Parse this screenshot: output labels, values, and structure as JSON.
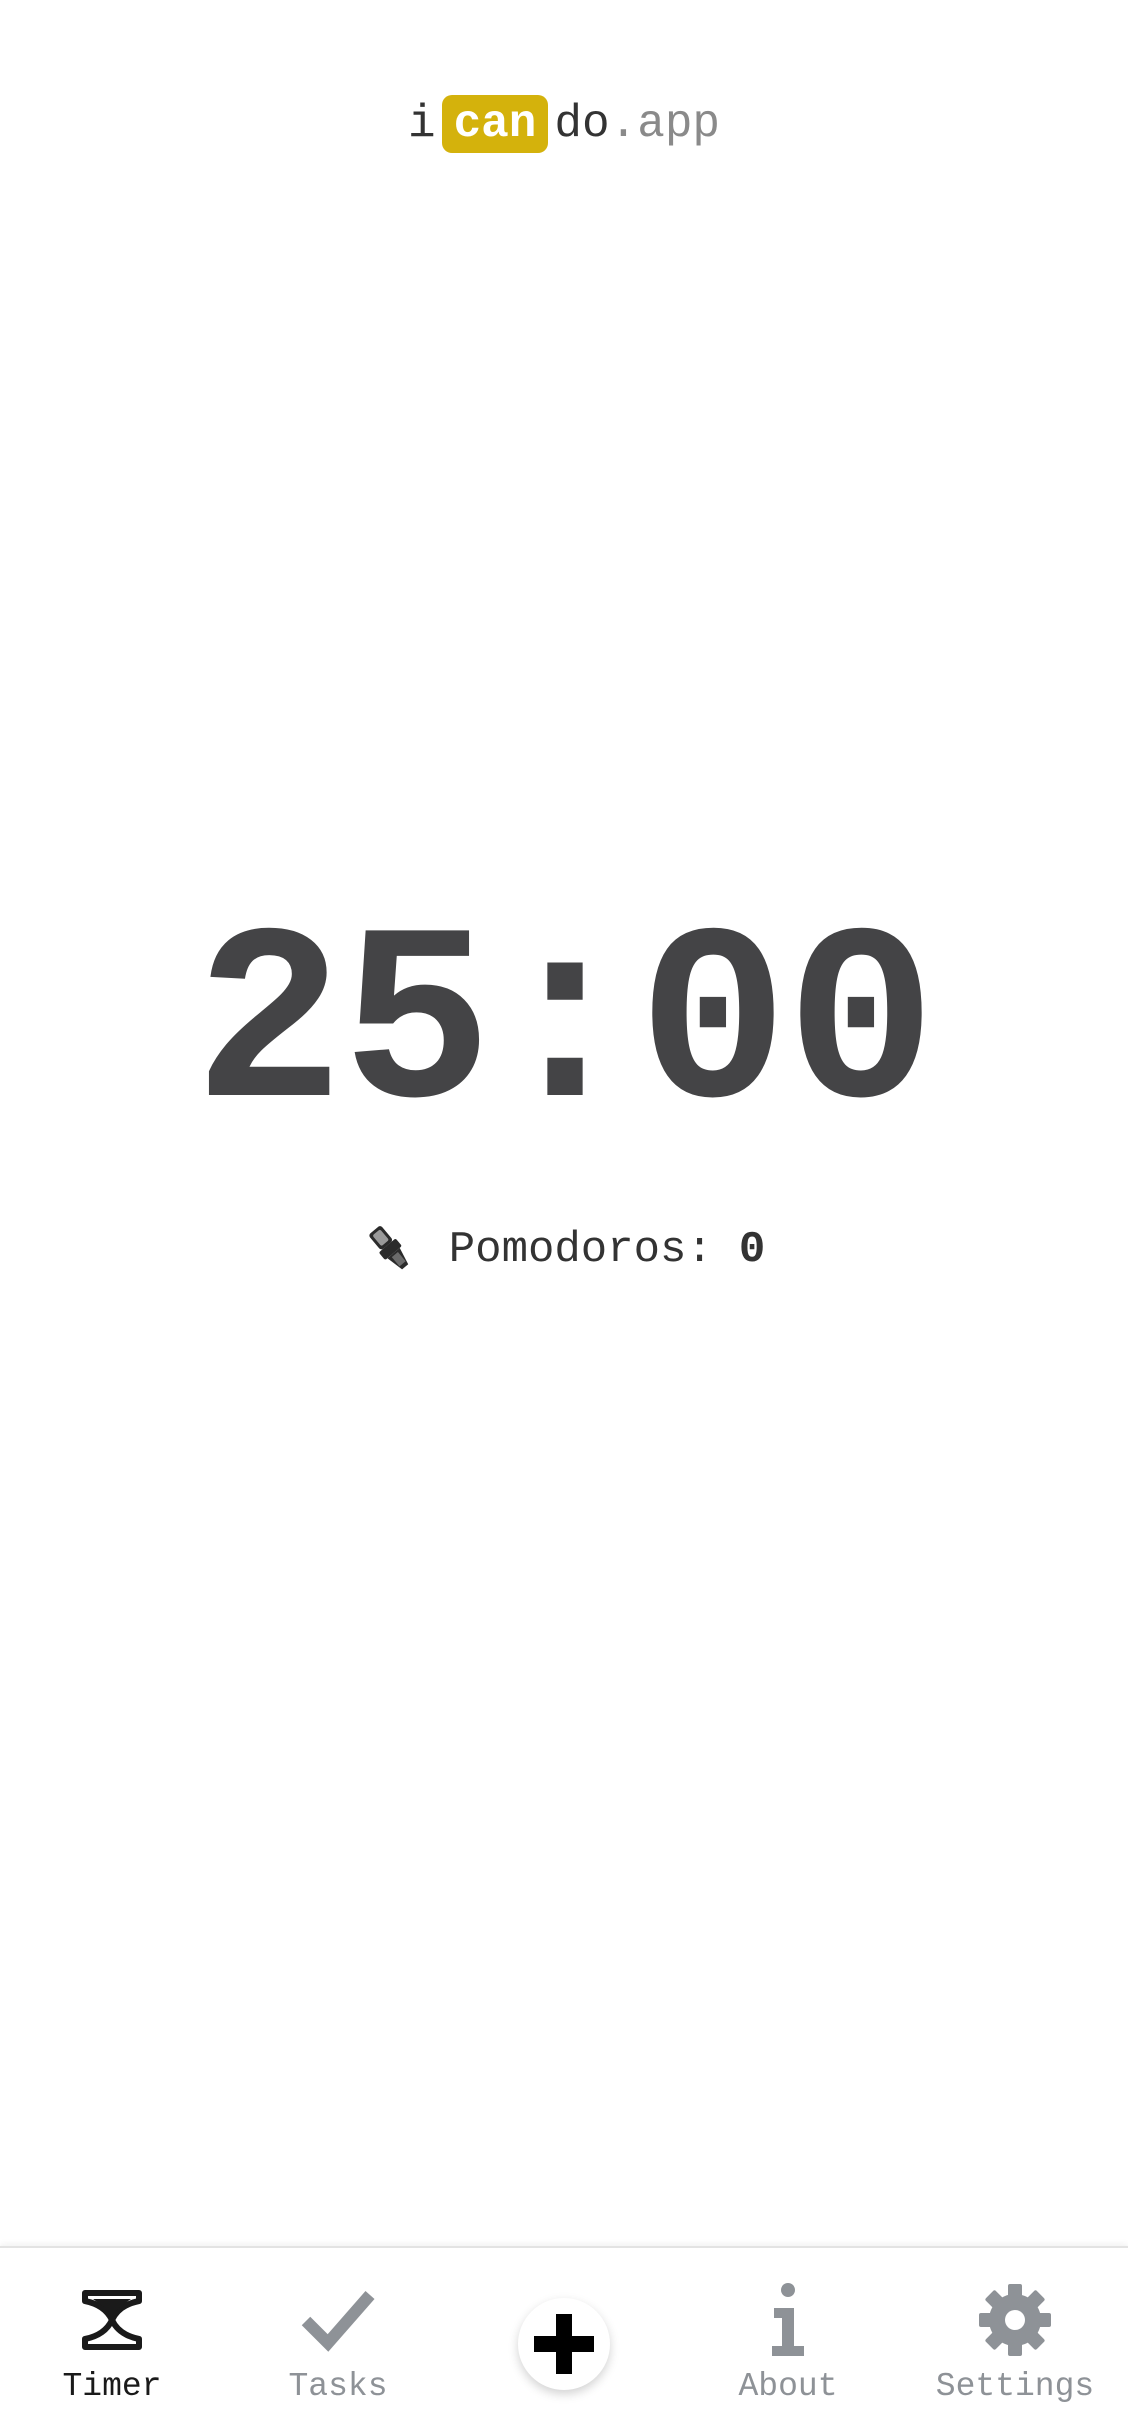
{
  "app": {
    "logo": {
      "part_i": "i",
      "part_can": "can",
      "part_do": "do",
      "part_app": ".app",
      "highlight_color": "#d4b20c"
    }
  },
  "timer": {
    "display": "25:00",
    "color": "#444446"
  },
  "pomodoros": {
    "icon": "tomato-icon",
    "label": "Pomodoros:",
    "count": "0"
  },
  "bottom_nav": {
    "items": [
      {
        "id": "timer",
        "label": "Timer",
        "icon": "hourglass-icon",
        "active": true
      },
      {
        "id": "tasks",
        "label": "Tasks",
        "icon": "checkmark-icon",
        "active": false
      },
      {
        "id": "add",
        "label": "",
        "icon": "plus-icon",
        "active": false
      },
      {
        "id": "about",
        "label": "About",
        "icon": "info-icon",
        "active": false
      },
      {
        "id": "settings",
        "label": "Settings",
        "icon": "gear-icon",
        "active": false
      }
    ],
    "active_color": "#1a1a1a",
    "inactive_color": "#8e9297"
  }
}
